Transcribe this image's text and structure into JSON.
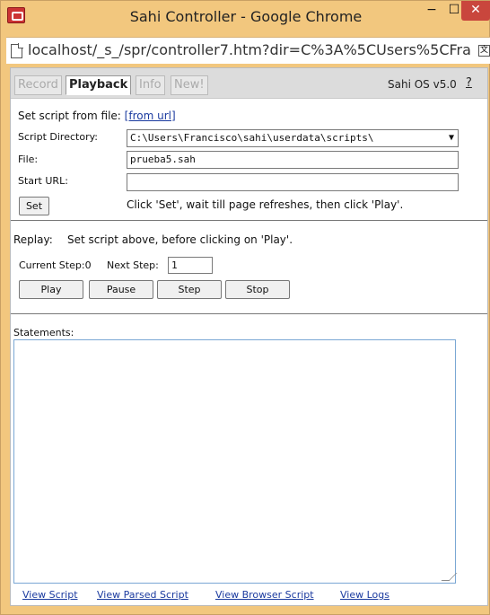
{
  "window": {
    "title": "Sahi Controller - Google Chrome",
    "minimize": "−",
    "maximize": "☐",
    "close": "✕"
  },
  "addressbar": {
    "url": "localhost/_s_/spr/controller7.htm?dir=C%3A%5CUsers%5CFra"
  },
  "tabs": [
    {
      "label": "Record",
      "active": false
    },
    {
      "label": "Playback",
      "active": true
    },
    {
      "label": "Info",
      "active": false
    },
    {
      "label": "New!",
      "active": false
    }
  ],
  "version": "Sahi OS v5.0",
  "help": "?",
  "script_section": {
    "set_script_label": "Set script from file:",
    "from_url_link": "[from url]",
    "script_dir_label": "Script Directory:",
    "script_dir_value": "C:\\Users\\Francisco\\sahi\\userdata\\scripts\\",
    "file_label": "File:",
    "file_value": "prueba5.sah",
    "start_url_label": "Start URL:",
    "start_url_value": "",
    "set_button": "Set",
    "set_hint": "Click 'Set', wait till page refreshes, then click 'Play'."
  },
  "replay_section": {
    "replay_label": "Replay:",
    "replay_hint": "Set script above, before clicking on 'Play'.",
    "current_step_label": "Current Step:0",
    "next_step_label": "Next Step:",
    "next_step_value": "1",
    "play_button": "Play",
    "pause_button": "Pause",
    "step_button": "Step",
    "stop_button": "Stop"
  },
  "statements_section": {
    "label": "Statements:",
    "links": [
      "View Script",
      "View Parsed Script",
      "View Browser Script",
      "View Logs"
    ]
  }
}
